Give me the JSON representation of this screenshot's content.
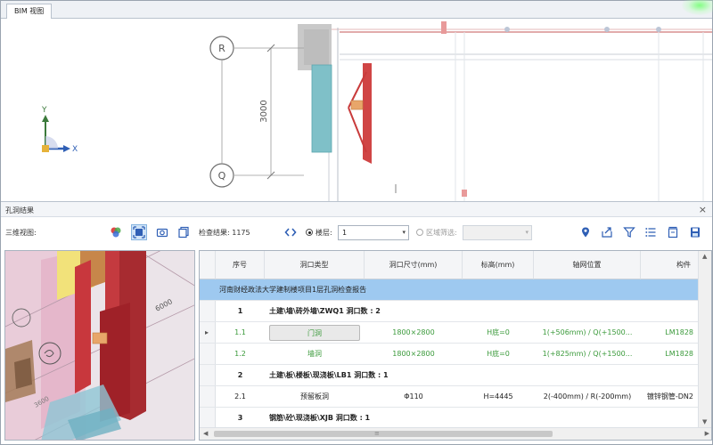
{
  "view": {
    "tab_label": "BIM 视图",
    "axis_labels": [
      "R",
      "Q"
    ],
    "dimension": "3000",
    "axis_x": "X",
    "axis_y": "Y"
  },
  "panel": {
    "title": "孔洞结果",
    "close": "×"
  },
  "toolbar": {
    "view3d_label": "三维视图:",
    "check_result": "检查结果: 1175",
    "floor_label": "楼层:",
    "floor_value": "1",
    "area_label": "区域筛选:",
    "area_value": ""
  },
  "preview": {
    "dimension": "6000",
    "dimension2": "3600"
  },
  "table": {
    "columns": [
      "序号",
      "洞口类型",
      "洞口尺寸(mm)",
      "标高(mm)",
      "轴网位置",
      "构件"
    ],
    "rows": [
      {
        "kind": "section",
        "title": "河南财经政法大学建制楼项目1层孔洞检查报告"
      },
      {
        "kind": "group",
        "no": "1",
        "title": "土建\\墙\\砖外墙\\ZWQ1  洞口数 : 2"
      },
      {
        "kind": "item",
        "marker": "▸",
        "no": "1.1",
        "type": "门洞",
        "size": "1800×2800",
        "elev": "H底=0",
        "axis": "1(+506mm) / Q(+1500...",
        "member": "LM1828",
        "selected": true
      },
      {
        "kind": "item",
        "no": "1.2",
        "type": "墙洞",
        "size": "1800×2800",
        "elev": "H底=0",
        "axis": "1(+825mm) / Q(+1500...",
        "member": "LM1828"
      },
      {
        "kind": "group",
        "no": "2",
        "title": "土建\\板\\楼板\\现浇板\\LB1  洞口数 : 1"
      },
      {
        "kind": "item",
        "no": "2.1",
        "type": "预留板洞",
        "size": "Φ110",
        "elev": "H=4445",
        "axis": "2(-400mm) / R(-200mm)",
        "member": "镀锌钢管-DN2",
        "dark": true
      },
      {
        "kind": "group",
        "no": "3",
        "title": "钢筋\\砼\\现浇板\\XJB  洞口数 : 1"
      }
    ]
  },
  "colors": {
    "section_bg": "#9ec9f0",
    "green_text": "#3b9a3b",
    "wall_red": "#c93b3b",
    "accent_blue": "#2f6fb5"
  }
}
